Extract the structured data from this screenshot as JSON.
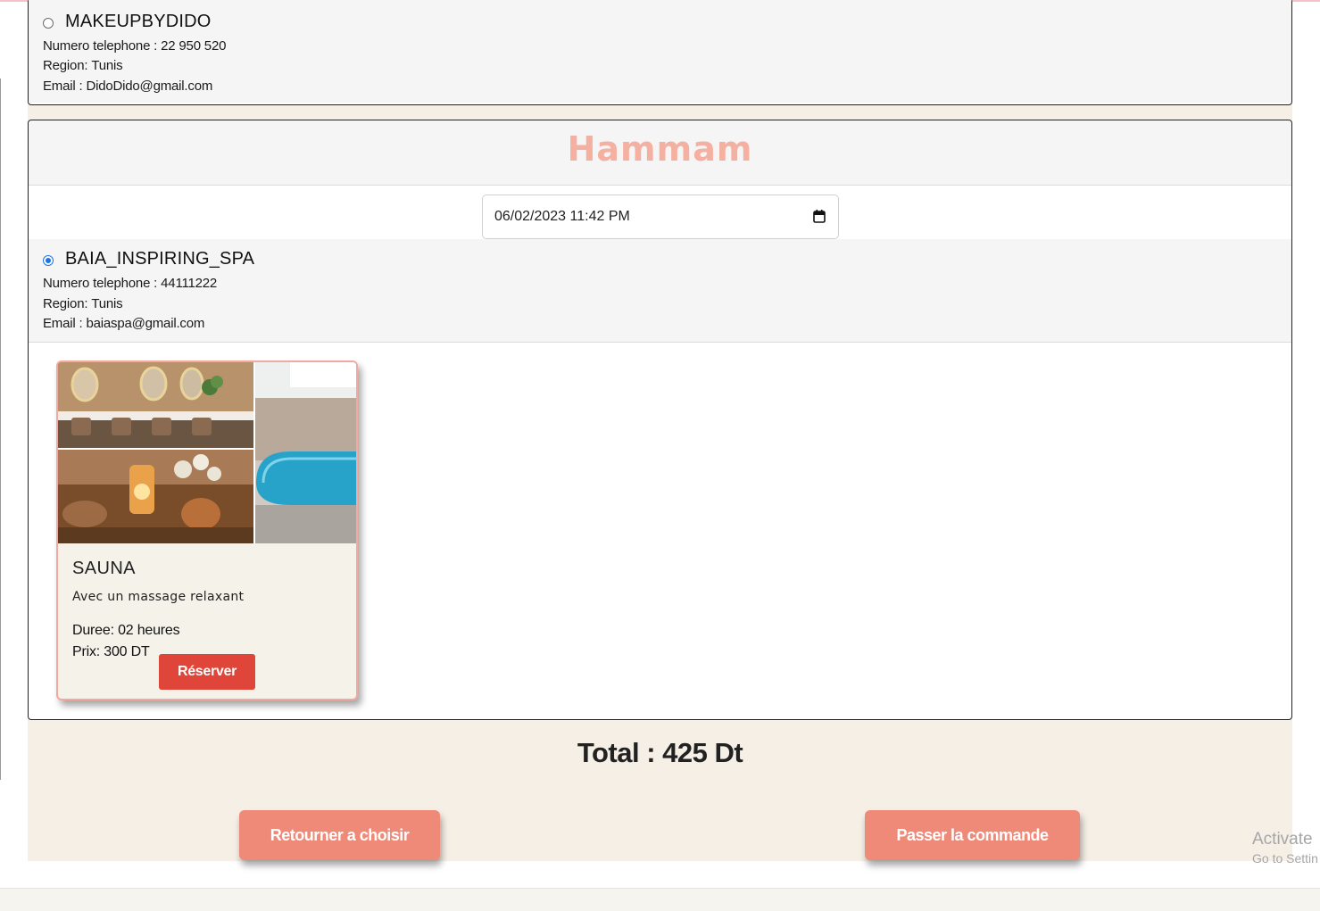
{
  "providers_makeup": {
    "name": "MAKEUPBYDIDO",
    "phone_label": "Numero telephone :",
    "phone": "22 950 520",
    "region_label": "Region:",
    "region": "Tunis",
    "email_label": "Email :",
    "email": "DidoDido@gmail.com",
    "selected": false
  },
  "hammam": {
    "title": "Hammam",
    "datetime_value": "06/02/2023 11:42 PM",
    "provider": {
      "name": "BAIA_INSPIRING_SPA",
      "phone_label": "Numero telephone :",
      "phone": "44111222",
      "region_label": "Region:",
      "region": "Tunis",
      "email_label": "Email :",
      "email": "baiaspa@gmail.com",
      "selected": true
    },
    "service": {
      "name": "SAUNA",
      "description": "Avec un massage relaxant",
      "duration": "Duree: 02 heures",
      "price": "Prix: 300 DT",
      "reserve_label": "Réserver"
    }
  },
  "total": "Total : 425 Dt",
  "buttons": {
    "back_label": "Retourner a choisir",
    "order_label": "Passer la commande"
  },
  "watermark": {
    "line1": "Activate",
    "line2": "Go to Settin"
  },
  "colors": {
    "section_title": "#f4b0a0",
    "reserve_button": "#e0453a",
    "action_button": "#f08a78",
    "card_border": "#f2a9a0",
    "page_beige": "#f5efe6"
  }
}
